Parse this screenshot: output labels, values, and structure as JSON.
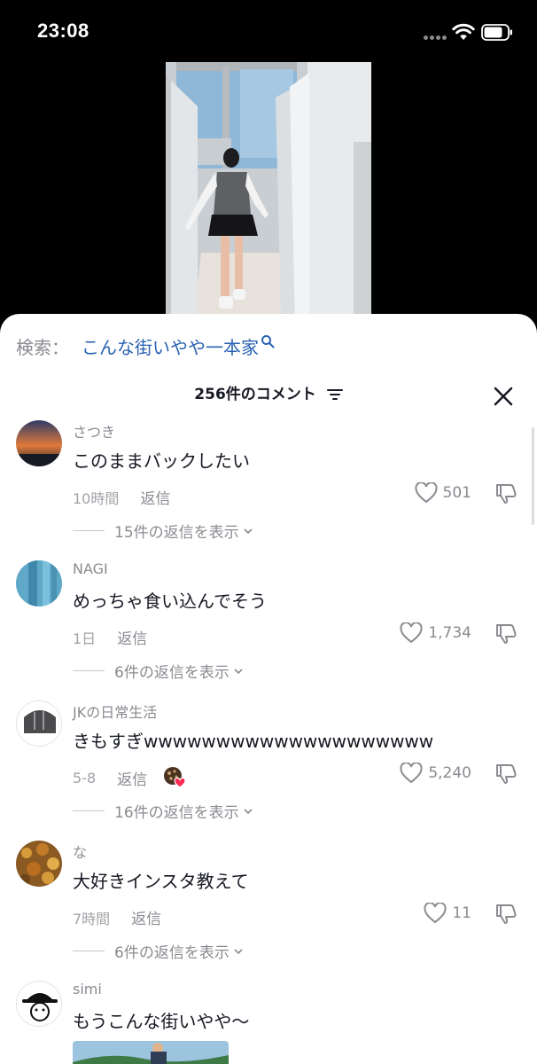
{
  "status_bar": {
    "time": "23:08"
  },
  "search": {
    "prefix": "検索：",
    "term": "こんな街いやや一本家"
  },
  "comments_header": {
    "title": "256件のコメント"
  },
  "comments": [
    {
      "user": "さつき",
      "text": "このままバックしたい",
      "time": "10時間",
      "reply": "返信",
      "likes": "501",
      "view_replies": "15件の返信を表示"
    },
    {
      "user": "NAGI",
      "text": "めっちゃ食い込んでそう",
      "time": "1日",
      "reply": "返信",
      "likes": "1,734",
      "view_replies": "6件の返信を表示"
    },
    {
      "user": "JKの日常生活",
      "text": "きもすぎwwwwwwwwwwwwwwwwwwww",
      "time": "5-8",
      "reply": "返信",
      "likes": "5,240",
      "view_replies": "16件の返信を表示"
    },
    {
      "user": "な",
      "text": "大好きインスタ教えて",
      "time": "7時間",
      "reply": "返信",
      "likes": "11",
      "view_replies": "6件の返信を表示"
    },
    {
      "user": "simi",
      "text": "もうこんな街いやや〜"
    }
  ],
  "colors": {
    "search_term": "#2a63b3",
    "muted": "#8a8b91",
    "text": "#161823",
    "creator_heart": "#fe2c55"
  },
  "icons": [
    "wifi-icon",
    "battery-icon",
    "search-icon",
    "filter-icon",
    "close-icon",
    "heart-icon",
    "dislike-icon",
    "chevron-down-icon"
  ]
}
